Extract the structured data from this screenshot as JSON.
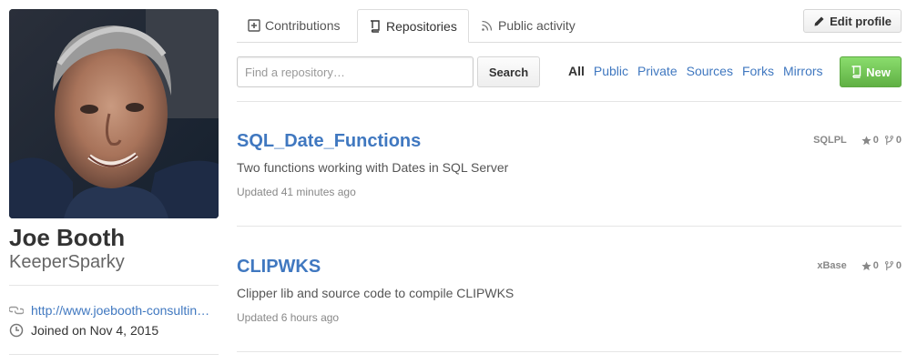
{
  "profile": {
    "fullname": "Joe Booth",
    "username": "KeeperSparky",
    "website": "http://www.joebooth-consultin…",
    "joined": "Joined on Nov 4, 2015"
  },
  "tabs": [
    {
      "label": "Contributions",
      "icon": "diff-added-icon"
    },
    {
      "label": "Repositories",
      "icon": "repo-book-icon",
      "selected": true
    },
    {
      "label": "Public activity",
      "icon": "rss-icon"
    }
  ],
  "edit_profile_label": "Edit profile",
  "search": {
    "placeholder": "Find a repository…",
    "value": "",
    "button_label": "Search"
  },
  "filters": [
    "All",
    "Public",
    "Private",
    "Sources",
    "Forks",
    "Mirrors"
  ],
  "active_filter": "All",
  "new_button_label": "New",
  "repos": [
    {
      "name": "SQL_Date_Functions",
      "description": "Two functions working with Dates in SQL Server",
      "updated": "Updated 41 minutes ago",
      "language": "SQLPL",
      "stars": "0",
      "forks": "0"
    },
    {
      "name": "CLIPWKS",
      "description": "Clipper lib and source code to compile CLIPWKS",
      "updated": "Updated 6 hours ago",
      "language": "xBase",
      "stars": "0",
      "forks": "0"
    }
  ],
  "colors": {
    "link": "#4078c0",
    "new_button": "#60b044",
    "text": "#333333",
    "muted": "#888888"
  }
}
